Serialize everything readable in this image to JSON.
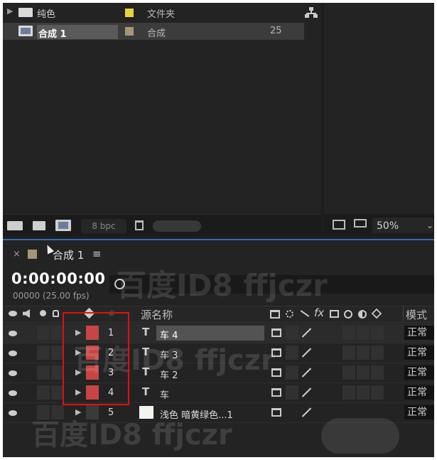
{
  "project": {
    "items": [
      {
        "name": "纯色",
        "type": "文件夹",
        "value": "",
        "swatch": "#e8d33a",
        "icon": "folder-icon"
      },
      {
        "name": "合成 1",
        "type": "合成",
        "value": "25",
        "swatch": "#a5967a",
        "icon": "composition-icon"
      }
    ],
    "bpc": "8 bpc",
    "flowchart_icon": "flowchart-icon"
  },
  "preview": {
    "zoom": "50%"
  },
  "timeline": {
    "tab_title": "合成 1",
    "tab_close": "×",
    "tab_menu": "≡",
    "timecode": "0:00:00:00",
    "frame_info": "00000 (25.00 fps)",
    "col_hash": "#",
    "col_source": "源名称",
    "col_mode": "模式",
    "col_fx": "fx",
    "layers": [
      {
        "num": "1",
        "name": "车 4",
        "type": "T",
        "mode": "正常",
        "selected": true
      },
      {
        "num": "2",
        "name": "车 3",
        "type": "T",
        "mode": "正常",
        "selected": false
      },
      {
        "num": "3",
        "name": "车 2",
        "type": "T",
        "mode": "正常",
        "selected": false
      },
      {
        "num": "4",
        "name": "车",
        "type": "T",
        "mode": "正常",
        "selected": false
      },
      {
        "num": "5",
        "name": "浅色 暗黄绿色...1",
        "type": "solid",
        "mode": "正常",
        "selected": false
      }
    ]
  },
  "watermark": "百度ID8 ffjczr",
  "colors": {
    "accent": "#2d6fb5",
    "label_red": "#c74545",
    "highlight_box": "#e01010"
  }
}
